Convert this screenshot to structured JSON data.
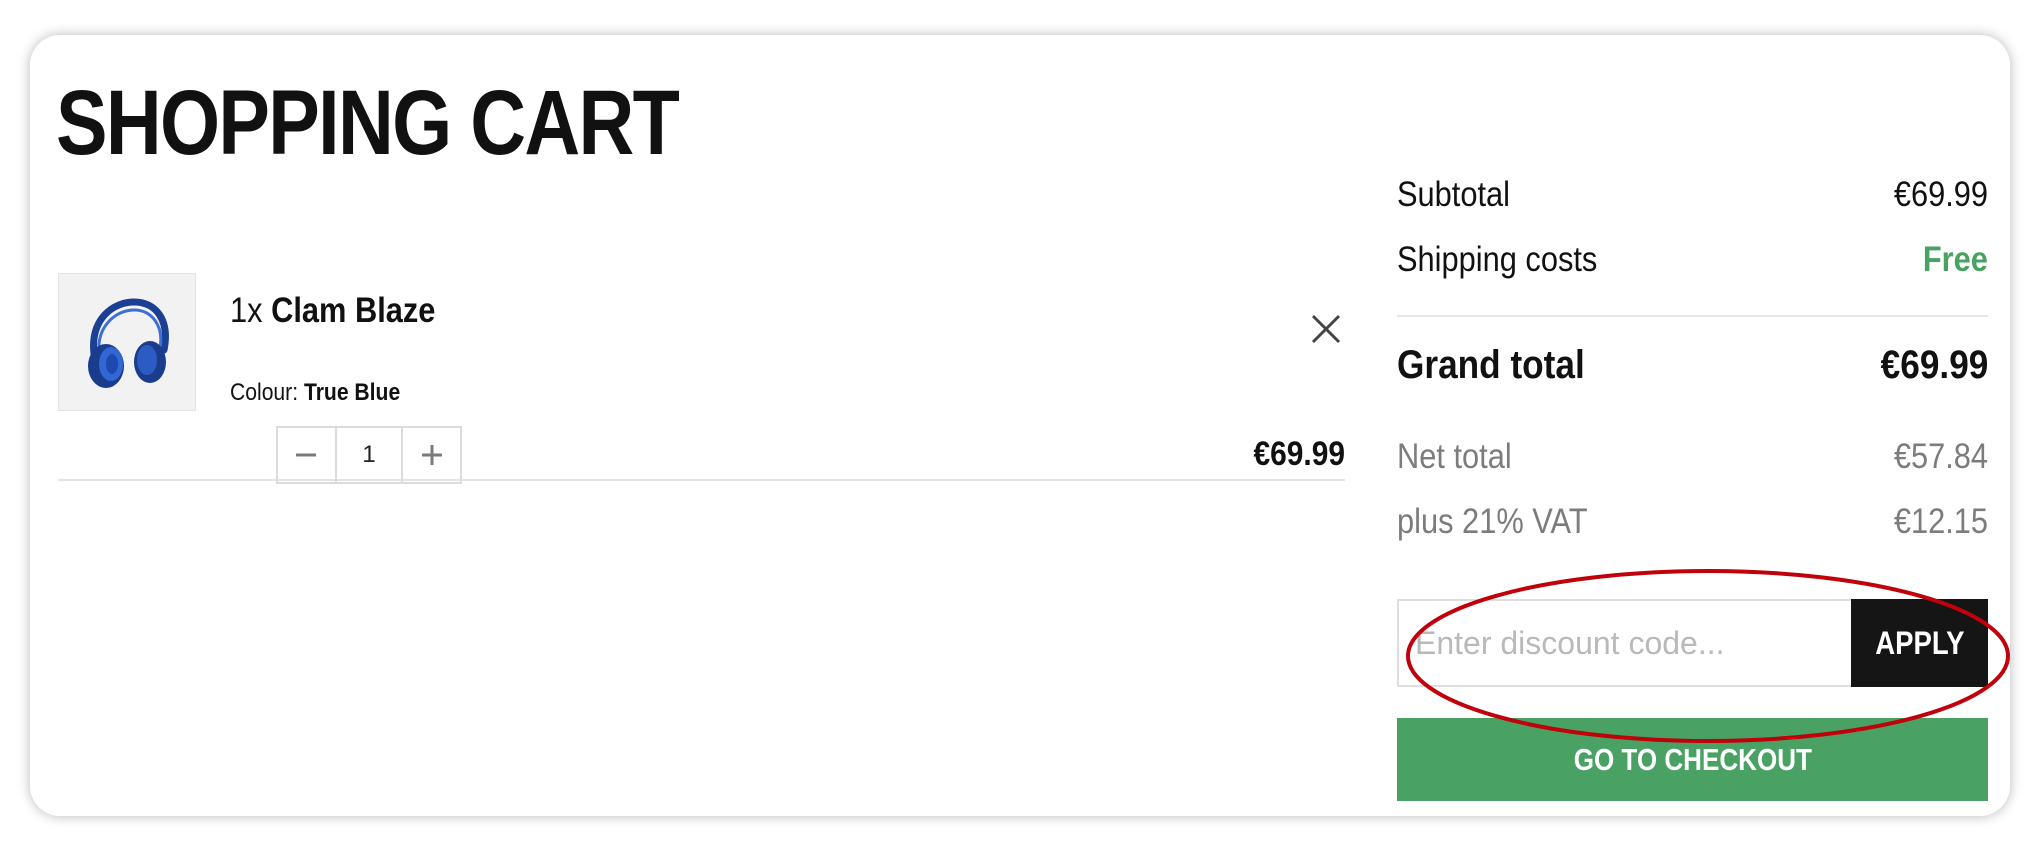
{
  "page": {
    "title": "SHOPPING CART"
  },
  "cart": {
    "items": [
      {
        "quantity_text": "1x",
        "name": "Clam Blaze",
        "colour_label": "Colour:",
        "colour_value": "True Blue",
        "quantity": "1",
        "price": "€69.99",
        "image_icon": "headphones-icon"
      }
    ]
  },
  "summary": {
    "subtotal_label": "Subtotal",
    "subtotal_value": "€69.99",
    "shipping_label": "Shipping costs",
    "shipping_value": "Free",
    "grand_total_label": "Grand total",
    "grand_total_value": "€69.99",
    "net_total_label": "Net total",
    "net_total_value": "€57.84",
    "vat_label": "plus 21% VAT",
    "vat_value": "€12.15"
  },
  "discount": {
    "placeholder": "Enter discount code...",
    "value": "",
    "apply_label": "APPLY"
  },
  "checkout": {
    "label": "GO TO CHECKOUT"
  },
  "colors": {
    "accent_green": "#4aa164",
    "button_dark": "#151515",
    "annotation_red": "#c0000a",
    "product_blue": "#1f4fb8"
  },
  "icons": {
    "remove": "close-icon",
    "decrease": "minus-icon",
    "increase": "plus-icon"
  }
}
